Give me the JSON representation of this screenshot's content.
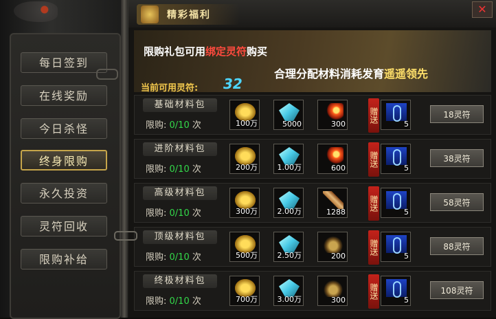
{
  "window": {
    "title": "精彩福利",
    "close_label": "✕"
  },
  "sidebar": {
    "items": [
      {
        "label": "每日签到",
        "active": false
      },
      {
        "label": "在线奖励",
        "active": false
      },
      {
        "label": "今日杀怪",
        "active": false
      },
      {
        "label": "终身限购",
        "active": true
      },
      {
        "label": "永久投资",
        "active": false
      },
      {
        "label": "灵符回收",
        "active": false
      },
      {
        "label": "限购补给",
        "active": false
      }
    ]
  },
  "banner": {
    "line1_a": "限购礼包可用",
    "line1_b": "绑定灵符",
    "line1_c": "购买",
    "line2_a": "合理分配材料消耗发育",
    "line2_b": "遥遥领先",
    "balance_label": "当前可用灵符:",
    "balance_value": "32"
  },
  "limit_label": "限购:",
  "limit_unit": "次",
  "gift_label": "赠送",
  "packages": [
    {
      "name": "基础材料包",
      "count": "0/10",
      "items": [
        "100万",
        "5000",
        "300"
      ],
      "gift_qty": "5",
      "price": "18灵符"
    },
    {
      "name": "进阶材料包",
      "count": "0/10",
      "items": [
        "200万",
        "1.00万",
        "600"
      ],
      "gift_qty": "5",
      "price": "38灵符"
    },
    {
      "name": "高级材料包",
      "count": "0/10",
      "items": [
        "300万",
        "2.00万",
        "1288"
      ],
      "gift_qty": "5",
      "price": "58灵符"
    },
    {
      "name": "顶级材料包",
      "count": "0/10",
      "items": [
        "500万",
        "2.50万",
        "200"
      ],
      "gift_qty": "5",
      "price": "88灵符"
    },
    {
      "name": "终极材料包",
      "count": "0/10",
      "items": [
        "700万",
        "3.00万",
        "300"
      ],
      "gift_qty": "5",
      "price": "108灵符"
    }
  ],
  "item_icons": [
    [
      "gold-ingot-icon",
      "crystal-icon",
      "fire-orb-icon"
    ],
    [
      "gold-ingot-icon",
      "crystal-icon",
      "fire-orb-icon"
    ],
    [
      "gold-ingot-icon",
      "crystal-icon",
      "scroll-icon"
    ],
    [
      "gold-ingot-icon",
      "crystal-icon",
      "serpent-icon"
    ],
    [
      "gold-ingot-icon",
      "crystal-icon",
      "serpent-icon"
    ]
  ],
  "gift_icon": "talisman-icon"
}
